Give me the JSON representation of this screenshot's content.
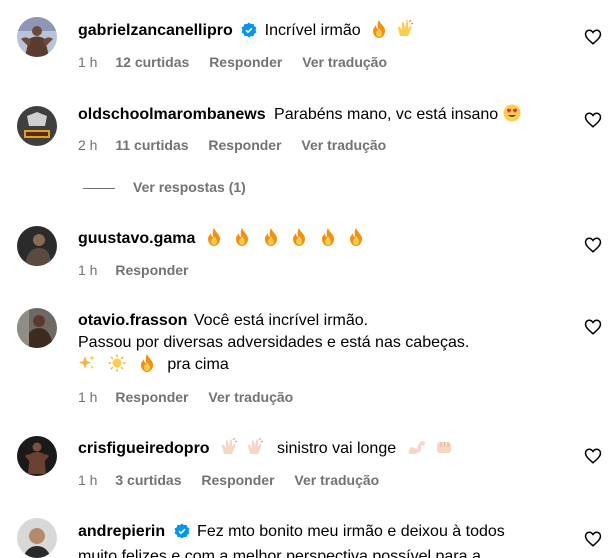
{
  "comments": [
    {
      "username": "gabrielzancanellipro",
      "verified": true,
      "text": "Incrível irmão",
      "emojis": [
        "fire-emoji",
        "clapping-hands-emoji"
      ],
      "time": "1 h",
      "likes": "12 curtidas",
      "reply_label": "Responder",
      "translate_label": "Ver tradução"
    },
    {
      "username": "oldschoolmarombanews",
      "verified": false,
      "text": "Parabéns mano, vc está insano",
      "emojis": [
        "heart-eyes-emoji"
      ],
      "time": "2 h",
      "likes": "11 curtidas",
      "reply_label": "Responder",
      "translate_label": "Ver tradução",
      "view_replies_label": "Ver respostas (1)"
    },
    {
      "username": "guustavo.gama",
      "verified": false,
      "text": "",
      "emojis": [
        "fire-emoji",
        "fire-emoji",
        "fire-emoji",
        "fire-emoji",
        "fire-emoji",
        "fire-emoji"
      ],
      "time": "1 h",
      "reply_label": "Responder"
    },
    {
      "username": "otavio.frasson",
      "verified": false,
      "text_line1": "Você está incrível irmão.",
      "text_line2": "Passou por diversas adversidades e está nas cabeças.",
      "text_line3": "pra cima",
      "emojis": [
        "sparkles-emoji",
        "sun-emoji",
        "fire-emoji"
      ],
      "time": "1 h",
      "reply_label": "Responder",
      "translate_label": "Ver tradução"
    },
    {
      "username": "crisfigueiredopro",
      "verified": false,
      "text": "sinistro vai longe",
      "emojis_before": [
        "clapping-hands-emoji",
        "clapping-hands-emoji"
      ],
      "emojis_after": [
        "flexed-biceps-emoji",
        "fist-emoji"
      ],
      "time": "1 h",
      "likes": "3 curtidas",
      "reply_label": "Responder",
      "translate_label": "Ver tradução"
    },
    {
      "username": "andrepierin",
      "verified": true,
      "text_line1": "Fez mto bonito meu irmão e deixou à todos",
      "text_line2": "muito felizes e com a melhor perspectiva possível para a"
    }
  ],
  "colors": {
    "secondary_text": "#737373",
    "verified_blue": "#0095f6",
    "fire": "#f4900c"
  }
}
